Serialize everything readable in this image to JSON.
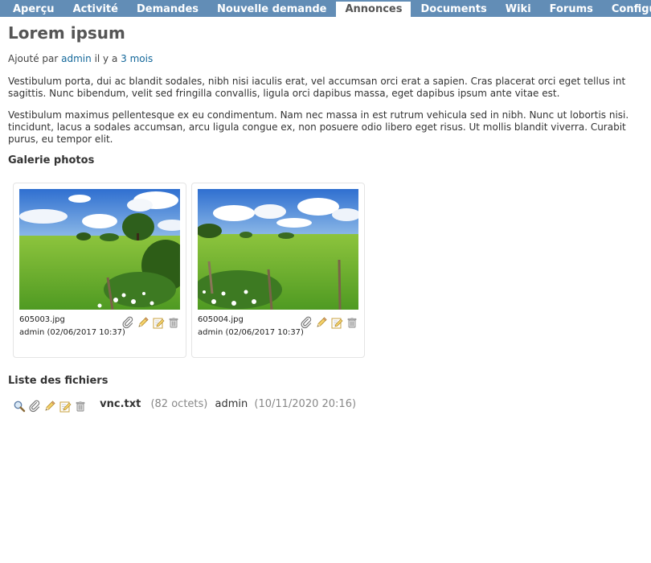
{
  "menu": {
    "tabs": [
      {
        "label": "Aperçu"
      },
      {
        "label": "Activité"
      },
      {
        "label": "Demandes"
      },
      {
        "label": "Nouvelle demande"
      },
      {
        "label": "Annonces",
        "selected": true
      },
      {
        "label": "Documents"
      },
      {
        "label": "Wiki"
      },
      {
        "label": "Forums"
      },
      {
        "label": "Configuration"
      }
    ]
  },
  "news": {
    "title": "Lorem ipsum",
    "author_prefix": "Ajouté par",
    "author": "admin",
    "age_prefix": "il y a",
    "age": "3 mois",
    "paragraph1": [
      "Vestibulum porta, dui ac blandit sodales, nibh nisi iaculis erat, vel accumsan orci erat a sapien. Cras placerat orci eget tellus int",
      "sagittis. Nunc bibendum, velit sed fringilla convallis, ligula orci dapibus massa, eget dapibus ipsum ante vitae est."
    ],
    "paragraph2": [
      "Vestibulum maximus pellentesque ex eu condimentum. Nam nec massa in est rutrum vehicula sed in nibh. Nunc ut lobortis nisi.",
      "tincidunt, lacus a sodales accumsan, arcu ligula congue ex, non posuere odio libero eget risus. Ut mollis blandit viverra. Curabit",
      "purus, eu tempor elit."
    ]
  },
  "gallery": {
    "heading": "Galerie photos",
    "photos": [
      {
        "filename": "605003.jpg",
        "meta": "admin (02/06/2017 10:37)"
      },
      {
        "filename": "605004.jpg",
        "meta": "admin (02/06/2017 10:37)"
      }
    ]
  },
  "files": {
    "heading": "Liste des fichiers",
    "items": [
      {
        "name": "vnc.txt",
        "size": "(82 octets)",
        "author": "admin",
        "date": "(10/11/2020 20:16)"
      }
    ]
  },
  "icons": {
    "magnifier": "magnifier-icon",
    "attachment": "paperclip-icon",
    "edit": "pencil-icon",
    "edit_page": "edit-page-icon",
    "delete": "trash-icon"
  },
  "colors": {
    "menu_bg": "#628db6",
    "link": "#169",
    "title": "#555"
  }
}
